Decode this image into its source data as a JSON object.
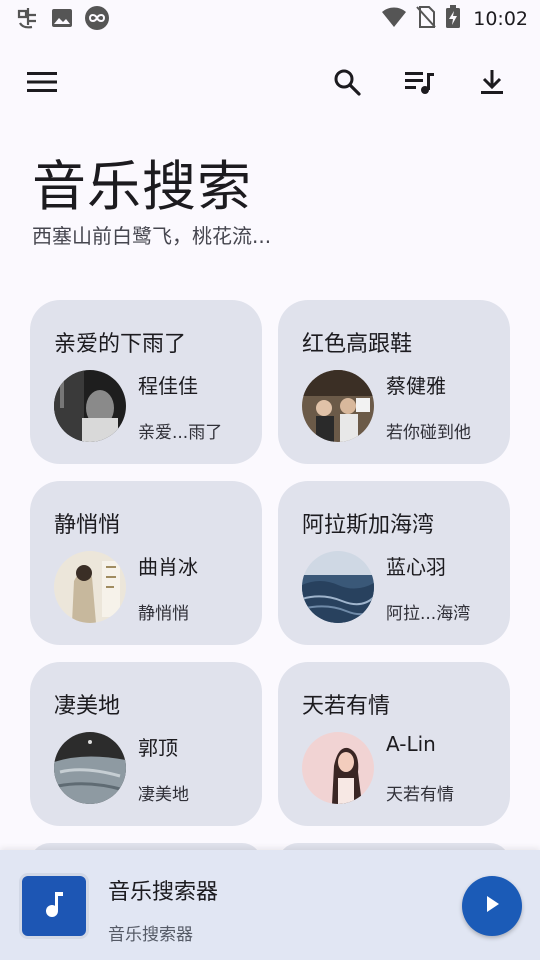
{
  "status_bar": {
    "time": "10:02",
    "left_icons": [
      "bug-notification-icon",
      "image-notification-icon",
      "infinity-notification-icon"
    ],
    "right_icons": [
      "wifi-icon",
      "no-sim-icon",
      "battery-charging-icon"
    ]
  },
  "toolbar": {
    "icons": [
      "menu-icon",
      "search-icon",
      "playlist-icon",
      "download-icon"
    ]
  },
  "header": {
    "title": "音乐搜索",
    "subtitle": "西塞山前白鹭飞，桃花流..."
  },
  "cards": [
    {
      "title": "亲爱的下雨了",
      "artist": "程佳佳",
      "album": "亲爱...雨了"
    },
    {
      "title": "红色高跟鞋",
      "artist": "蔡健雅",
      "album": "若你碰到他"
    },
    {
      "title": "静悄悄",
      "artist": "曲肖冰",
      "album": "静悄悄"
    },
    {
      "title": "阿拉斯加海湾",
      "artist": "蓝心羽",
      "album": "阿拉...海湾"
    },
    {
      "title": "凄美地",
      "artist": "郭顶",
      "album": "凄美地"
    },
    {
      "title": "天若有情",
      "artist": "A-Lin",
      "album": "天若有情"
    }
  ],
  "player": {
    "title": "音乐搜索器",
    "subtitle": "音乐搜索器"
  },
  "colors": {
    "background": "#fbf9fe",
    "card": "#e0e2ec",
    "player_bar": "#e1e6f3",
    "accent": "#1b5bb7"
  }
}
